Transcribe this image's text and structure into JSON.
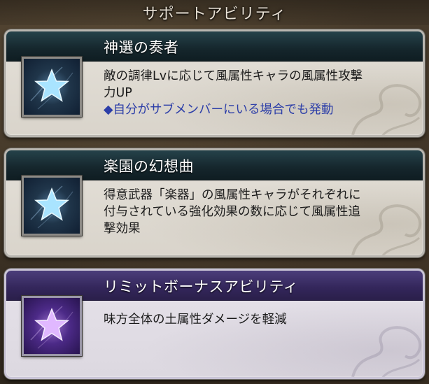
{
  "header": {
    "title": "サポートアビリティ"
  },
  "abilities": [
    {
      "name": "神選の奏者",
      "lines": [
        "敵の調律Lvに応じて風属性キャラの風属性攻撃",
        "力UP"
      ],
      "note": "◆自分がサブメンバーにいる場合でも発動",
      "icon": "star-icon",
      "icon_color": "#8fd8ff"
    },
    {
      "name": "楽園の幻想曲",
      "lines": [
        "得意武器「楽器」の風属性キャラがそれぞれに",
        "付与されている強化効果の数に応じて風属性追",
        "撃効果"
      ],
      "icon": "star-icon",
      "icon_color": "#8fd8ff"
    }
  ],
  "limit": {
    "title": "リミットボーナスアビリティ",
    "lines": [
      "味方全体の土属性ダメージを軽減"
    ],
    "icon": "star-icon",
    "icon_color": "#d9a8ff"
  },
  "colors": {
    "support_header": "#15262c",
    "limit_header": "#33265a",
    "note_text": "#2c3ea8"
  }
}
